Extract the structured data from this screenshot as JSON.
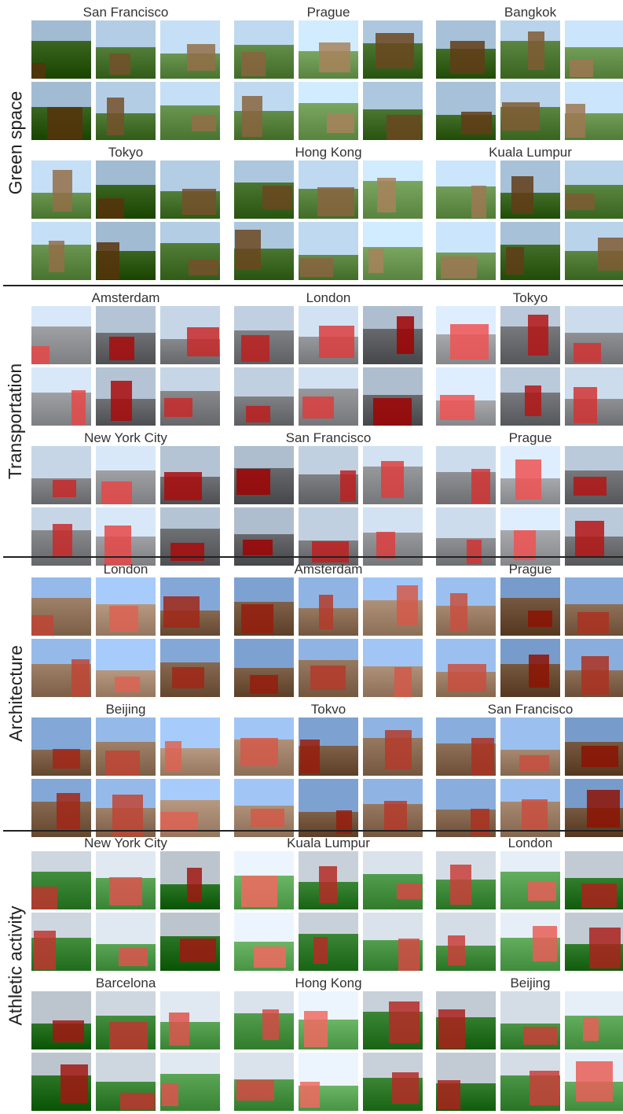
{
  "sections": [
    {
      "label": "Green space",
      "cities": [
        "San Francisco",
        "Prague",
        "Bangkok",
        "Tokyo",
        "Hong Kong",
        "Kuala Lumpur"
      ],
      "palette": {
        "sky": "#b9d3ea",
        "ground": "#4f7a36",
        "accent": "#7f5a34"
      }
    },
    {
      "label": "Transportation",
      "cities": [
        "Amsterdam",
        "London",
        "Tokyo",
        "New York City",
        "San Francisco",
        "Prague"
      ],
      "palette": {
        "sky": "#c6d6e6",
        "ground": "#7b7d80",
        "accent": "#c82a2a"
      }
    },
    {
      "label": "Architecture",
      "cities": [
        "London",
        "Amsterdam",
        "Prague",
        "Beijing",
        "Tokvo",
        "San Francisco"
      ],
      "palette": {
        "sky": "#8fb4e4",
        "ground": "#8a6d54",
        "accent": "#b53b2b"
      }
    },
    {
      "label": "Athletic activity",
      "cities": [
        "New York City",
        "Kuala Lumpur",
        "London",
        "Barcelona",
        "Hong Kong",
        "Beijing"
      ],
      "palette": {
        "sky": "#d4dde6",
        "ground": "#3f8a3a",
        "accent": "#c9403a"
      }
    }
  ]
}
